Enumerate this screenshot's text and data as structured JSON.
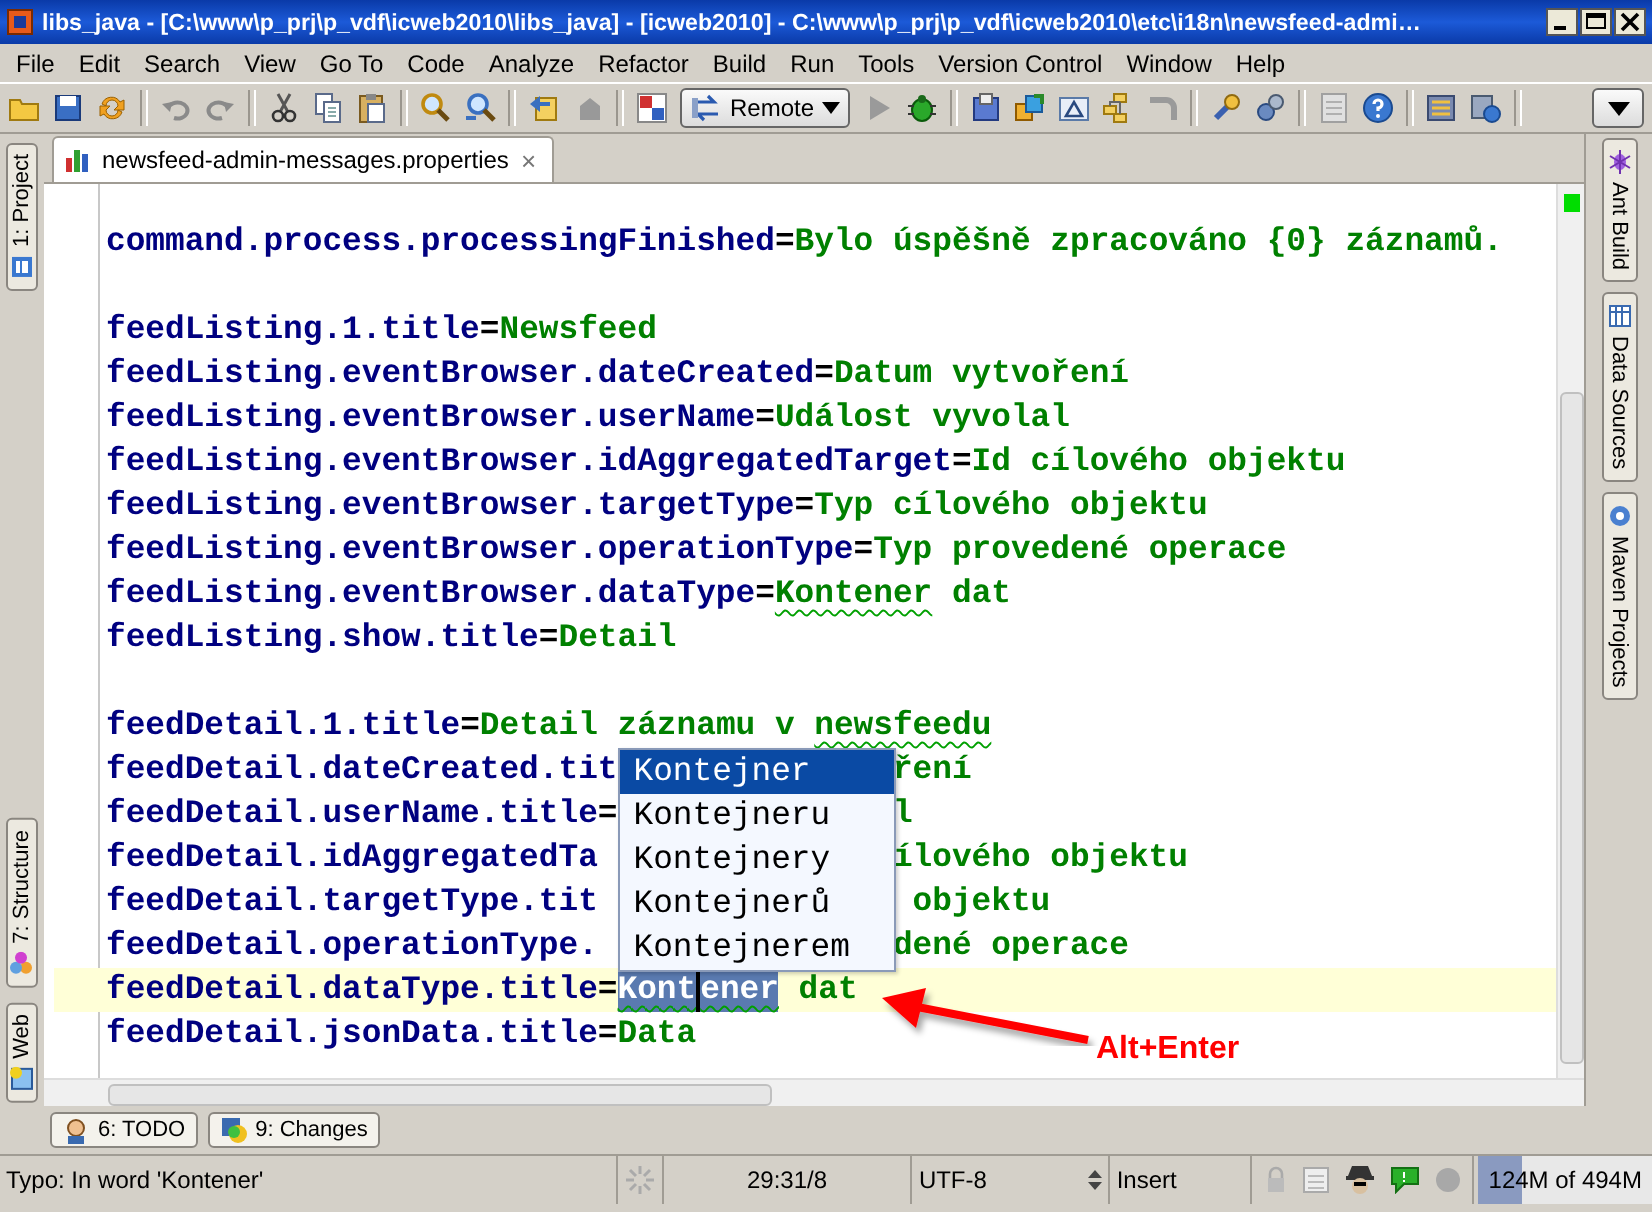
{
  "window": {
    "title": "libs_java - [C:\\www\\p_prj\\p_vdf\\icweb2010\\libs_java] - [icweb2010] - C:\\www\\p_prj\\p_vdf\\icweb2010\\etc\\i18n\\newsfeed-admi…"
  },
  "menu": [
    "File",
    "Edit",
    "Search",
    "View",
    "Go To",
    "Code",
    "Analyze",
    "Refactor",
    "Build",
    "Run",
    "Tools",
    "Version Control",
    "Window",
    "Help"
  ],
  "toolbar": {
    "run_config": "Remote"
  },
  "editor_tab": {
    "label": "newsfeed-admin-messages.properties",
    "close": "×"
  },
  "left_tools": [
    "1: Project",
    "7: Structure",
    "Web"
  ],
  "right_tools": [
    "Ant Build",
    "Data Sources",
    "Maven Projects"
  ],
  "lines": [
    {
      "kind": "text",
      "current": false,
      "parts": [
        {
          "kind": "key",
          "text": "command.process.processingFinished"
        },
        {
          "kind": "sep",
          "text": "="
        },
        {
          "kind": "value",
          "text": "Bylo úspěšně zpracováno {0} záznamů."
        }
      ]
    },
    {
      "kind": "blank",
      "current": false
    },
    {
      "kind": "text",
      "current": false,
      "parts": [
        {
          "kind": "key",
          "text": "feedListing.1.title"
        },
        {
          "kind": "sep",
          "text": "="
        },
        {
          "kind": "value",
          "text": "Newsfeed"
        }
      ]
    },
    {
      "kind": "text",
      "current": false,
      "parts": [
        {
          "kind": "key",
          "text": "feedListing.eventBrowser.dateCreated"
        },
        {
          "kind": "sep",
          "text": "="
        },
        {
          "kind": "value",
          "text": "Datum vytvoření"
        }
      ]
    },
    {
      "kind": "text",
      "current": false,
      "parts": [
        {
          "kind": "key",
          "text": "feedListing.eventBrowser.userName"
        },
        {
          "kind": "sep",
          "text": "="
        },
        {
          "kind": "value",
          "text": "Událost vyvolal"
        }
      ]
    },
    {
      "kind": "text",
      "current": false,
      "parts": [
        {
          "kind": "key",
          "text": "feedListing.eventBrowser.idAggregatedTarget"
        },
        {
          "kind": "sep",
          "text": "="
        },
        {
          "kind": "value",
          "text": "Id cílového objektu"
        }
      ]
    },
    {
      "kind": "text",
      "current": false,
      "parts": [
        {
          "kind": "key",
          "text": "feedListing.eventBrowser.targetType"
        },
        {
          "kind": "sep",
          "text": "="
        },
        {
          "kind": "value",
          "text": "Typ cílového objektu"
        }
      ]
    },
    {
      "kind": "text",
      "current": false,
      "parts": [
        {
          "kind": "key",
          "text": "feedListing.eventBrowser.operationType"
        },
        {
          "kind": "sep",
          "text": "="
        },
        {
          "kind": "value",
          "text": "Typ provedené operace"
        }
      ]
    },
    {
      "kind": "text",
      "current": false,
      "parts": [
        {
          "kind": "key",
          "text": "feedListing.eventBrowser.dataType"
        },
        {
          "kind": "sep",
          "text": "="
        },
        {
          "kind": "typo",
          "text": "Kontener"
        },
        {
          "kind": "value",
          "text": " dat"
        }
      ]
    },
    {
      "kind": "text",
      "current": false,
      "parts": [
        {
          "kind": "key",
          "text": "feedListing.show.title"
        },
        {
          "kind": "sep",
          "text": "="
        },
        {
          "kind": "value",
          "text": "Detail"
        }
      ]
    },
    {
      "kind": "blank",
      "current": false
    },
    {
      "kind": "text",
      "current": false,
      "parts": [
        {
          "kind": "key",
          "text": "feedDetail.1.title"
        },
        {
          "kind": "sep",
          "text": "="
        },
        {
          "kind": "value",
          "text": "Detail záznamu v "
        },
        {
          "kind": "typo",
          "text": "newsfeedu"
        }
      ]
    },
    {
      "kind": "text",
      "current": false,
      "parts": [
        {
          "kind": "key",
          "text": "feedDetail.dateCreated.tit"
        },
        {
          "kind": "gap"
        },
        {
          "kind": "value",
          "text": "ření"
        }
      ]
    },
    {
      "kind": "text",
      "current": false,
      "parts": [
        {
          "kind": "key",
          "text": "feedDetail.userName.title"
        },
        {
          "kind": "sep",
          "text": "="
        },
        {
          "kind": "gap"
        },
        {
          "kind": "value",
          "text": "l"
        }
      ]
    },
    {
      "kind": "text",
      "current": false,
      "parts": [
        {
          "kind": "key",
          "text": "feedDetail.idAggregatedTa"
        },
        {
          "kind": "gap"
        },
        {
          "kind": "value",
          "text": "ílového objektu"
        }
      ]
    },
    {
      "kind": "text",
      "current": false,
      "parts": [
        {
          "kind": "key",
          "text": "feedDetail.targetType.tit"
        },
        {
          "kind": "gap"
        },
        {
          "kind": "value",
          "text": " objektu"
        }
      ]
    },
    {
      "kind": "text",
      "current": false,
      "parts": [
        {
          "kind": "key",
          "text": "feedDetail.operationType."
        },
        {
          "kind": "gap"
        },
        {
          "kind": "value",
          "text": "dené operace"
        }
      ]
    },
    {
      "kind": "text",
      "current": true,
      "parts": [
        {
          "kind": "key",
          "text": "feedDetail.dataType.title"
        },
        {
          "kind": "sep",
          "text": "="
        },
        {
          "kind": "selection",
          "text": "Kont"
        },
        {
          "kind": "caret"
        },
        {
          "kind": "selection",
          "text": "ener"
        },
        {
          "kind": "value",
          "text": " dat"
        }
      ]
    },
    {
      "kind": "text",
      "current": false,
      "parts": [
        {
          "kind": "key",
          "text": "feedDetail.jsonData.title"
        },
        {
          "kind": "sep",
          "text": "="
        },
        {
          "kind": "value",
          "text": "Data"
        }
      ]
    }
  ],
  "completion": {
    "items": [
      {
        "label": "Kontejner",
        "selected": true
      },
      {
        "label": "Kontejneru",
        "selected": false
      },
      {
        "label": "Kontejnery",
        "selected": false
      },
      {
        "label": "Kontejnerů",
        "selected": false
      },
      {
        "label": "Kontejnerem",
        "selected": false
      }
    ]
  },
  "annotation": {
    "text": "Alt+Enter"
  },
  "bottom_tools": [
    "6: TODO",
    "9: Changes"
  ],
  "status_bar": {
    "message": "Typo: In word 'Kontener'",
    "position": "29:31/8",
    "encoding": "UTF-8",
    "mode": "Insert",
    "memory": {
      "text": "124M of 494M",
      "level": 0.25
    }
  }
}
